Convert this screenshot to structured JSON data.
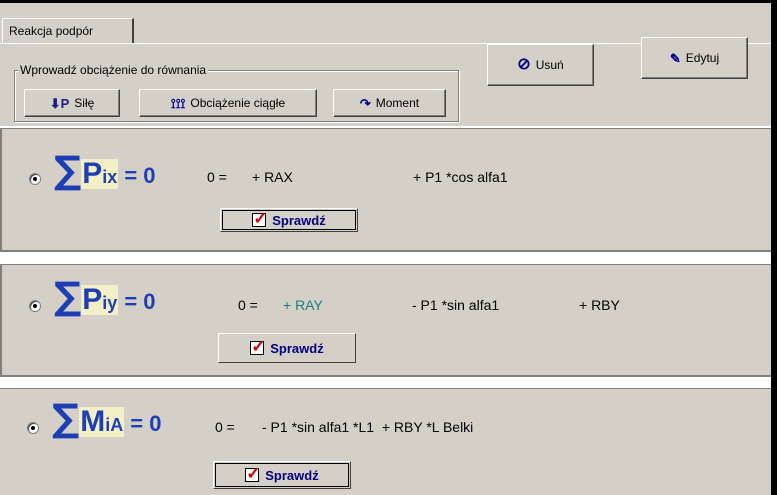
{
  "tab": {
    "label": "Reakcja podpór"
  },
  "group": {
    "title": "Wprowadź obciążenie do równania"
  },
  "buttons": {
    "sily": {
      "icon": "force-arrow-icon",
      "icon_glyph": "⬇P",
      "label": "Siłę"
    },
    "ciagle": {
      "icon": "distributed-load-icon",
      "icon_glyph": "⟟⟟⟟",
      "label": "Obciążenie ciągłe"
    },
    "moment": {
      "icon": "moment-icon",
      "icon_glyph": "↷",
      "label": "Moment"
    },
    "usun": {
      "icon": "no-entry-icon",
      "icon_glyph": "⊘",
      "label": "Usuń"
    },
    "edytuj": {
      "icon": "edit-document-icon",
      "icon_glyph": "✎",
      "label": "Edytuj"
    }
  },
  "equations": [
    {
      "sigma": "∑",
      "symbol": "P",
      "subscript": "ix",
      "equals": "= 0",
      "lhs": "0 =",
      "term1": "+ RAX",
      "term2": "+ P1 *cos alfa1",
      "check_label": "Sprawdź"
    },
    {
      "sigma": "∑",
      "symbol": "P",
      "subscript": "iy",
      "equals": "= 0",
      "lhs": "0 =",
      "term1": "+ RAY",
      "term2": "- P1 *sin alfa1",
      "term3": "+ RBY",
      "check_label": "Sprawdź"
    },
    {
      "sigma": "∑",
      "symbol": "M",
      "subscript": "iA",
      "equals": "= 0",
      "lhs": "0 =",
      "term1": "- P1 *sin alfa1 *L1  + RBY *L Belki",
      "check_label": "Sprawdź"
    }
  ],
  "colors": {
    "face": "#d4d0c8",
    "sigma_blue": "#1e3fb4",
    "teal": "#1a8080"
  }
}
